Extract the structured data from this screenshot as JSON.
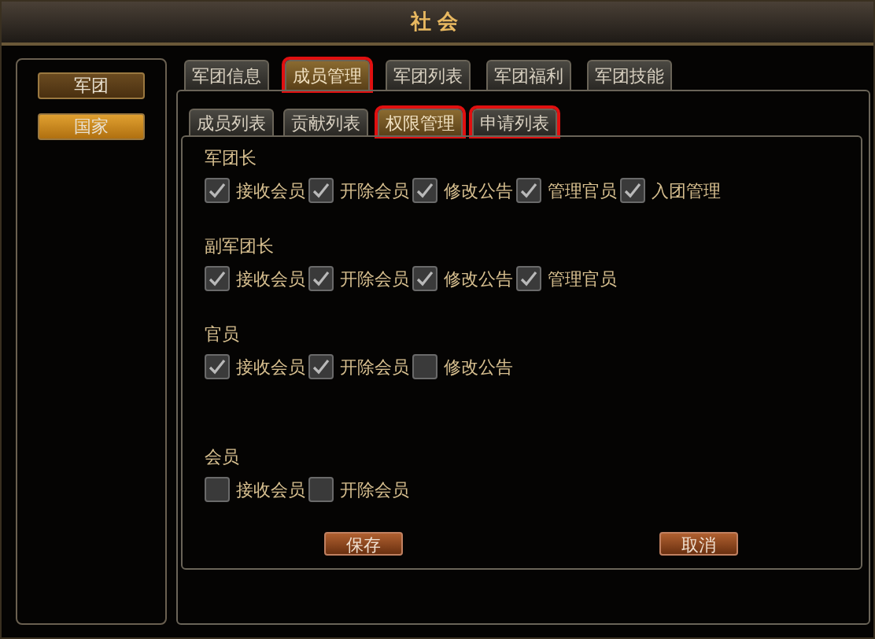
{
  "window": {
    "title": "社会"
  },
  "sidebar": {
    "items": [
      {
        "label": "军团",
        "selected": false
      },
      {
        "label": "国家",
        "selected": true
      }
    ]
  },
  "tabs": [
    {
      "label": "军团信息",
      "selected": false,
      "highlighted": false
    },
    {
      "label": "成员管理",
      "selected": true,
      "highlighted": true
    },
    {
      "label": "军团列表",
      "selected": false,
      "highlighted": false
    },
    {
      "label": "军团福利",
      "selected": false,
      "highlighted": false
    },
    {
      "label": "军团技能",
      "selected": false,
      "highlighted": false
    }
  ],
  "subtabs": [
    {
      "label": "成员列表",
      "selected": false,
      "highlighted": false
    },
    {
      "label": "贡献列表",
      "selected": false,
      "highlighted": false
    },
    {
      "label": "权限管理",
      "selected": true,
      "highlighted": true
    },
    {
      "label": "申请列表",
      "selected": false,
      "highlighted": true
    }
  ],
  "roles": [
    {
      "name": "军团长",
      "permissions": [
        {
          "label": "接收会员",
          "checked": true
        },
        {
          "label": "开除会员",
          "checked": true
        },
        {
          "label": "修改公告",
          "checked": true
        },
        {
          "label": "管理官员",
          "checked": true
        },
        {
          "label": "入团管理",
          "checked": true
        }
      ]
    },
    {
      "name": "副军团长",
      "permissions": [
        {
          "label": "接收会员",
          "checked": true
        },
        {
          "label": "开除会员",
          "checked": true
        },
        {
          "label": "修改公告",
          "checked": true
        },
        {
          "label": "管理官员",
          "checked": true
        }
      ]
    },
    {
      "name": "官员",
      "permissions": [
        {
          "label": "接收会员",
          "checked": true
        },
        {
          "label": "开除会员",
          "checked": true
        },
        {
          "label": "修改公告",
          "checked": false
        }
      ]
    },
    {
      "name": "会员",
      "permissions": [
        {
          "label": "接收会员",
          "checked": false
        },
        {
          "label": "开除会员",
          "checked": false
        }
      ]
    }
  ],
  "buttons": [
    "保存",
    "取消"
  ]
}
